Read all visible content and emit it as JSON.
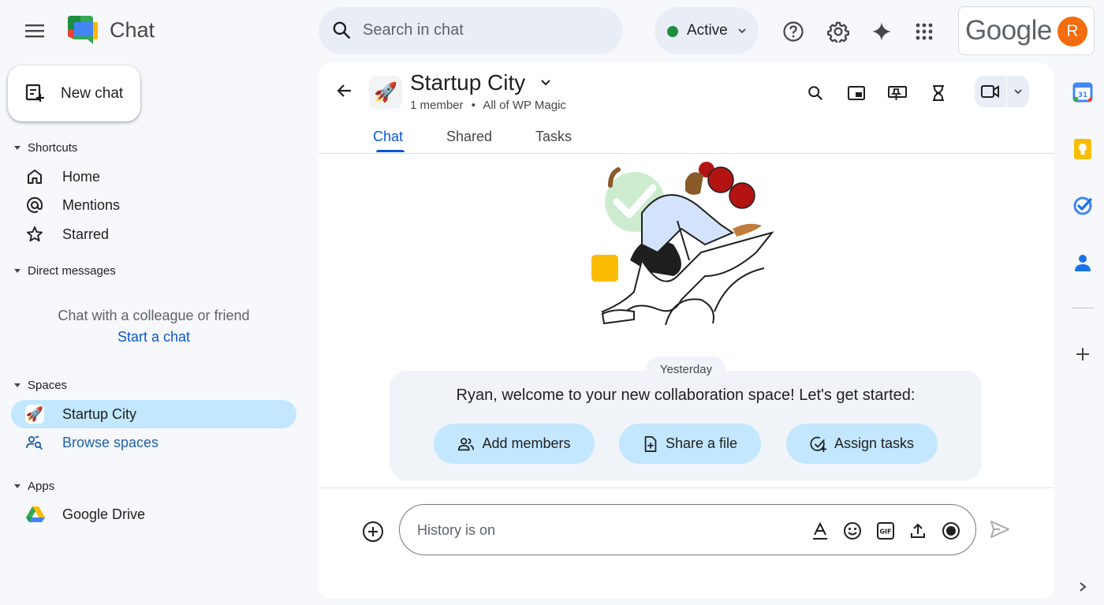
{
  "app": {
    "name": "Chat"
  },
  "search": {
    "placeholder": "Search in chat"
  },
  "status": {
    "label": "Active",
    "color": "#1e8e3e"
  },
  "account": {
    "brand": "Google",
    "avatar_initial": "R",
    "avatar_color": "#f36c0d"
  },
  "sidebar": {
    "new_chat_label": "New chat",
    "shortcuts": {
      "header": "Shortcuts",
      "items": [
        {
          "label": "Home",
          "icon": "home-icon"
        },
        {
          "label": "Mentions",
          "icon": "at-icon"
        },
        {
          "label": "Starred",
          "icon": "star-icon"
        }
      ]
    },
    "direct_messages": {
      "header": "Direct messages",
      "empty_text": "Chat with a colleague or friend",
      "start_link": "Start a chat"
    },
    "spaces": {
      "header": "Spaces",
      "items": [
        {
          "label": "Startup City",
          "icon": "rocket-icon",
          "active": true
        },
        {
          "label": "Browse spaces",
          "icon": "browse-spaces-icon",
          "active": false
        }
      ]
    },
    "apps": {
      "header": "Apps",
      "items": [
        {
          "label": "Google Drive",
          "icon": "google-drive-icon"
        }
      ]
    }
  },
  "space": {
    "emoji": "🚀",
    "title": "Startup City",
    "members": "1 member",
    "separator": "•",
    "organization": "All of WP Magic",
    "tabs": [
      {
        "label": "Chat",
        "active": true
      },
      {
        "label": "Shared",
        "active": false
      },
      {
        "label": "Tasks",
        "active": false
      }
    ]
  },
  "conversation": {
    "date_chip": "Yesterday",
    "welcome_text": "Ryan, welcome to your new collaboration space! Let's get started:",
    "actions": [
      {
        "label": "Add members",
        "icon": "add-members-icon"
      },
      {
        "label": "Share a file",
        "icon": "share-file-icon"
      },
      {
        "label": "Assign tasks",
        "icon": "assign-tasks-icon"
      }
    ]
  },
  "composer": {
    "placeholder": "History is on"
  },
  "colors": {
    "accent": "#0b57d0",
    "selected_bg": "#c2e7ff",
    "page_bg": "#f6f8fc"
  }
}
